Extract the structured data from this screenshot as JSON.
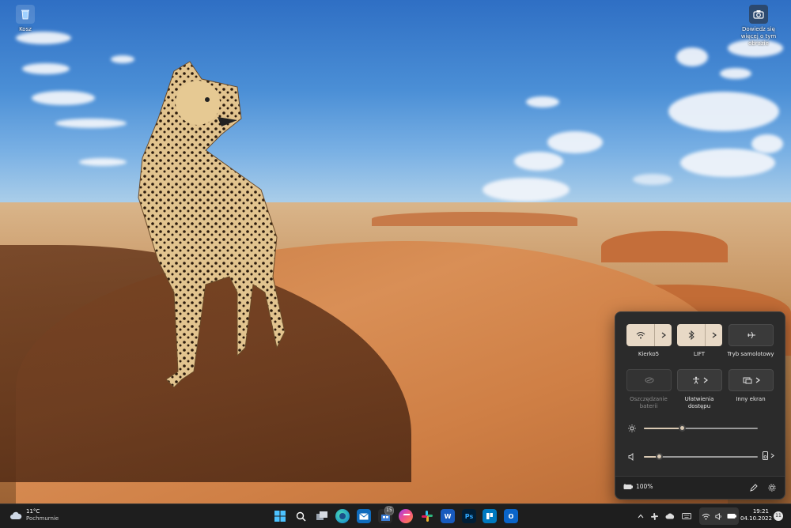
{
  "desktop": {
    "recycle_bin_label": "Kosz",
    "spotlight_label": "Dowiedz się więcej o tym obrazie"
  },
  "quick_settings": {
    "tiles": [
      {
        "label": "Kierko5",
        "icon": "wifi-icon",
        "state": "on"
      },
      {
        "label": "LIFT",
        "icon": "bluetooth-icon",
        "state": "on"
      },
      {
        "label": "Tryb samolotowy",
        "icon": "airplane-icon",
        "state": "off"
      },
      {
        "label": "Oszczędzanie baterii",
        "icon": "battery-saver-icon",
        "state": "disabled"
      },
      {
        "label": "Ułatwienia dostępu",
        "icon": "accessibility-icon",
        "state": "off"
      },
      {
        "label": "Inny ekran",
        "icon": "cast-icon",
        "state": "off"
      }
    ],
    "brightness": 0.33,
    "volume": 0.13,
    "battery": "100%",
    "colors": {
      "accent": "#e8d9c6",
      "panel": "#2b2b2b"
    }
  },
  "taskbar": {
    "weather_temp": "11°C",
    "weather_desc": "Pochmurnie",
    "badge_count": "15",
    "time": "19:21",
    "date": "04.10.2022",
    "notification_count": "11",
    "apps": [
      "start-icon",
      "search-icon",
      "task-view-icon",
      "edge-icon",
      "mail-icon",
      "store-icon",
      "messenger-icon",
      "slack-icon",
      "word-icon",
      "photoshop-icon",
      "trello-icon",
      "outlook-icon"
    ]
  }
}
